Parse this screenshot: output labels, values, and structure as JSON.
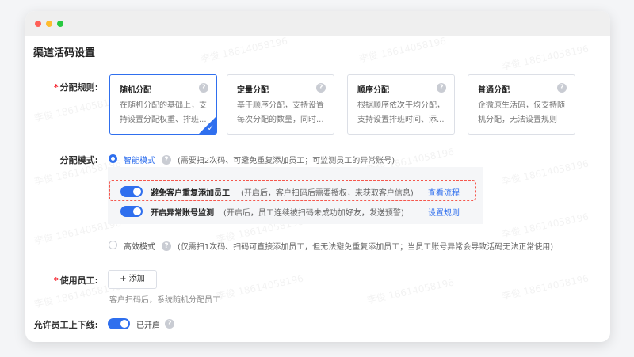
{
  "page_title": "渠道活码设置",
  "watermark_text": "李俊 18614058196",
  "distribution_rule": {
    "label": "分配规则:",
    "required_mark": "*",
    "cards": [
      {
        "title": "随机分配",
        "desc": "在随机分配的基础上，支持设置分配权重、排班...",
        "selected": true,
        "help_icon": "question-icon"
      },
      {
        "title": "定量分配",
        "desc": "基于顺序分配，支持设置每次分配的数量，同时...",
        "selected": false,
        "help_icon": "question-icon"
      },
      {
        "title": "顺序分配",
        "desc": "根据顺序依次平均分配，支持设置排班时间、添...",
        "selected": false,
        "help_icon": "question-icon"
      },
      {
        "title": "普通分配",
        "desc": "企微原生活码，仅支持随机分配，无法设置规则",
        "selected": false,
        "help_icon": "question-icon"
      }
    ]
  },
  "distribution_mode": {
    "label": "分配模式:",
    "smart": {
      "label": "智能模式",
      "hint": "(需要扫2次码、可避免重复添加员工；可监测员工的异常账号)",
      "checked": true
    },
    "options": [
      {
        "label": "避免客户重复添加员工",
        "hint": "(开启后，客户扫码后需要授权，来获取客户信息)",
        "link": "查看流程",
        "enabled": true
      },
      {
        "label": "开启异常账号监测",
        "hint": "(开启后，员工连续被扫码未成功加好友，发送预警)",
        "link": "设置规则",
        "enabled": true
      }
    ],
    "efficient": {
      "label": "高效模式",
      "hint": "(仅需扫1次码、扫码可直接添加员工，但无法避免重复添加员工；当员工账号异常会导致活码无法正常使用)",
      "checked": false
    }
  },
  "staff": {
    "label": "使用员工:",
    "required_mark": "*",
    "add_button": "+ 添加",
    "hint": "客户扫码后，系统随机分配员工"
  },
  "online_toggle": {
    "label": "允许员工上下线:",
    "status": "已开启",
    "enabled": true
  },
  "colors": {
    "accent": "#2f6fee",
    "required": "#f5222d",
    "dashed_border": "#f5574d"
  }
}
